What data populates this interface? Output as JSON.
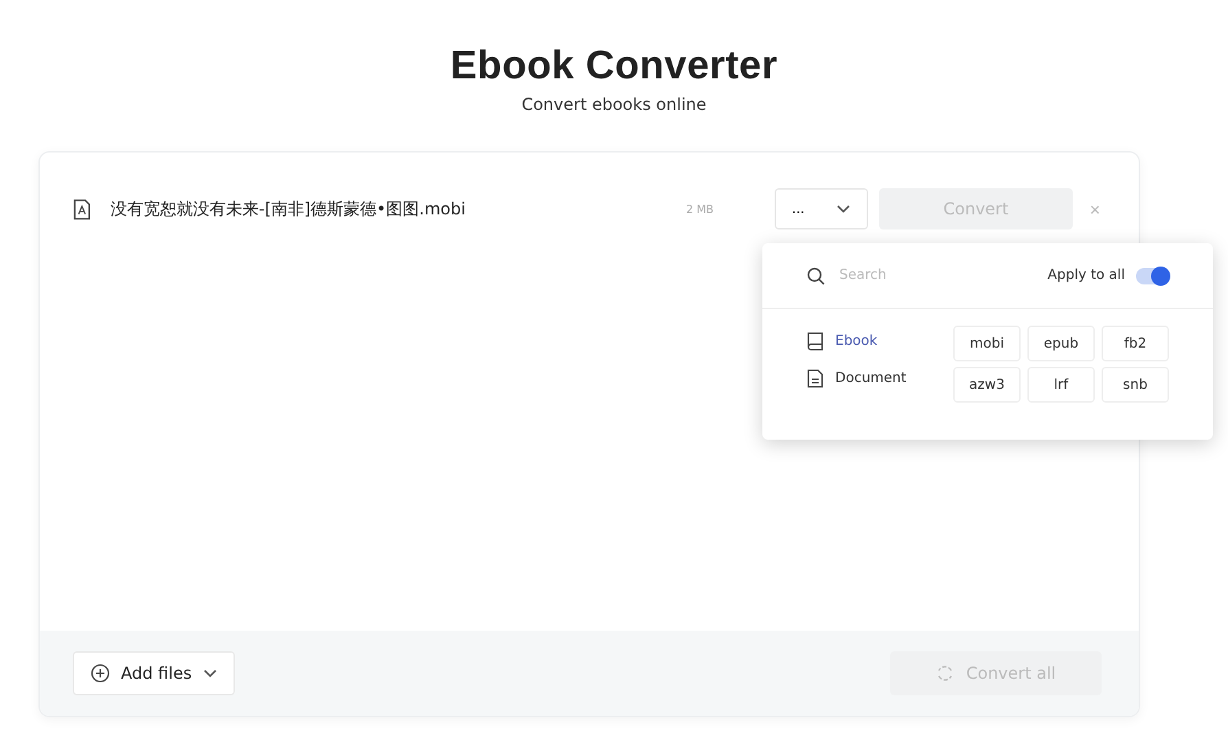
{
  "header": {
    "title": "Ebook Converter",
    "subtitle": "Convert ebooks online"
  },
  "file": {
    "name": "没有宽恕就没有未来-[南非]德斯蒙德•图图.mobi",
    "size": "2 MB",
    "format": "...",
    "convert": {
      "label": "Convert",
      "disabled": true
    },
    "remove": "×"
  },
  "popup": {
    "search": {
      "placeholder": "Search"
    },
    "apply_to_all": {
      "label": "Apply to all",
      "on": true
    },
    "categories": [
      {
        "label": "Ebook",
        "kind": "book",
        "selected": true
      },
      {
        "label": "Document",
        "kind": "document",
        "selected": false
      }
    ],
    "formats": [
      "mobi",
      "epub",
      "fb2",
      "azw3",
      "lrf",
      "snb"
    ]
  },
  "footer": {
    "add_files": "Add files",
    "convert_all": {
      "label": "Convert all",
      "disabled": true
    }
  }
}
